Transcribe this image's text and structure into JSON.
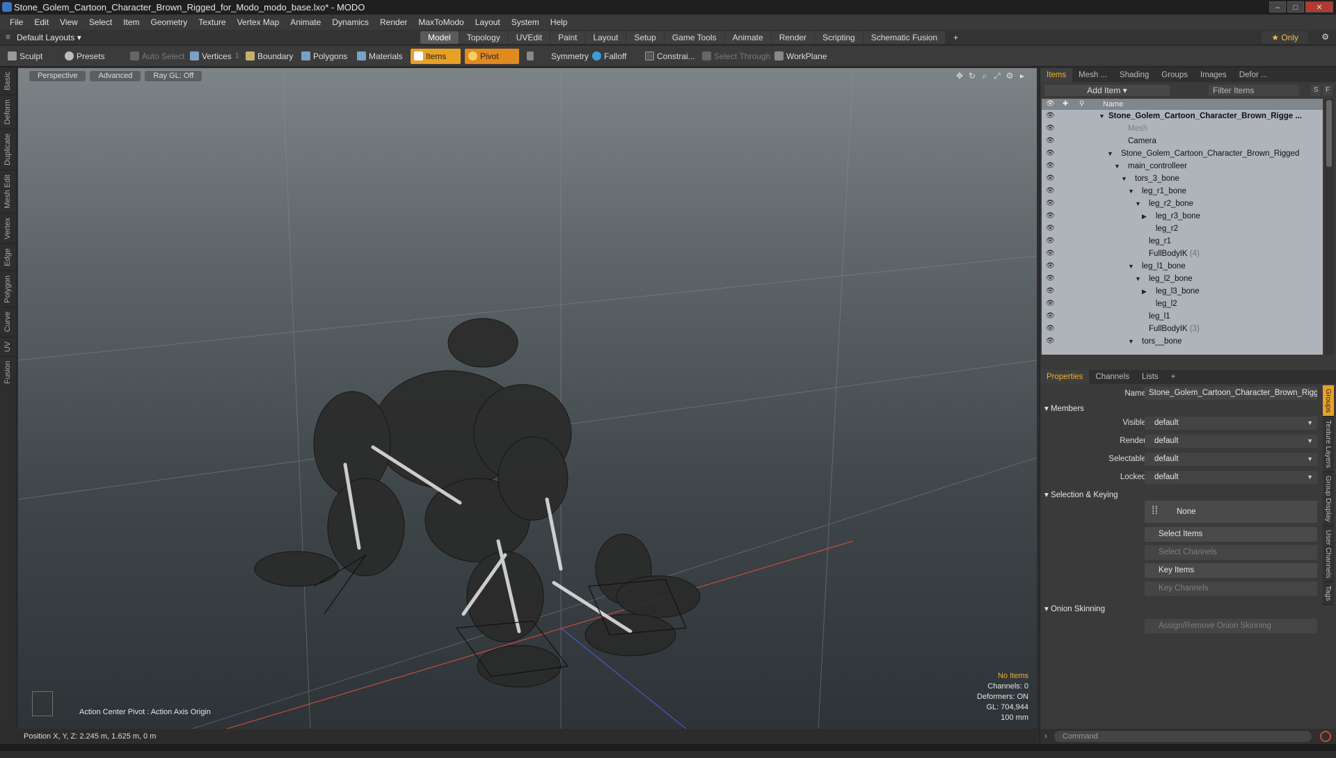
{
  "window": {
    "title": "Stone_Golem_Cartoon_Character_Brown_Rigged_for_Modo_modo_base.lxo* - MODO"
  },
  "menu": [
    "File",
    "Edit",
    "View",
    "Select",
    "Item",
    "Geometry",
    "Texture",
    "Vertex Map",
    "Animate",
    "Dynamics",
    "Render",
    "MaxToModo",
    "Layout",
    "System",
    "Help"
  ],
  "layout_bar": {
    "layout_selector": "Default Layouts",
    "tabs": [
      "Model",
      "Topology",
      "UVEdit",
      "Paint",
      "Layout",
      "Setup",
      "Game Tools",
      "Animate",
      "Render",
      "Scripting",
      "Schematic Fusion"
    ],
    "add_tab": "+",
    "only_label": "Only"
  },
  "toolbar": {
    "sculpt": "Sculpt",
    "presets": "Presets",
    "auto_select": "Auto Select",
    "vertices": "Vertices",
    "vertices_count": "1",
    "boundary": "Boundary",
    "polygons": "Polygons",
    "materials": "Materials",
    "items": "Items",
    "pivot": "Pivot",
    "symmetry": "Symmetry",
    "falloff": "Falloff",
    "constrain": "Constrai...",
    "select_through": "Select Through",
    "workplane": "WorkPlane"
  },
  "left_tabs": [
    "Basic",
    "Deform",
    "Duplicate",
    "Mesh Edit",
    "Vertex",
    "Edge",
    "Polygon",
    "Curve",
    "UV",
    "Fusion"
  ],
  "viewport": {
    "view_mode": "Perspective",
    "shading": "Advanced",
    "raygl": "Ray GL: Off",
    "action_center": "Action Center Pivot : Action Axis Origin",
    "hud": {
      "no_items": "No Items",
      "channels": "Channels: 0",
      "deformers": "Deformers: ON",
      "gl": "GL: 704,944",
      "scale": "100 mm"
    }
  },
  "status_bar": {
    "position_label": "Position X, Y, Z:",
    "position_value": "2.245 m, 1.625 m, 0 m"
  },
  "items_panel": {
    "tabs": [
      "Items",
      "Mesh ...",
      "Shading",
      "Groups",
      "Images",
      "Defor ..."
    ],
    "add_item": "Add Item",
    "filter_placeholder": "Filter Items",
    "s_btn": "S",
    "f_btn": "F",
    "column_name": "Name",
    "rows": [
      {
        "label": "Stone_Golem_Cartoon_Character_Brown_Rigge ...",
        "count": ""
      },
      {
        "label": "Mesh",
        "count": ""
      },
      {
        "label": "Camera",
        "count": ""
      },
      {
        "label": "Stone_Golem_Cartoon_Character_Brown_Rigged",
        "count": ""
      },
      {
        "label": "main_controlleer",
        "count": ""
      },
      {
        "label": "tors_3_bone",
        "count": ""
      },
      {
        "label": "leg_r1_bone",
        "count": ""
      },
      {
        "label": "leg_r2_bone",
        "count": ""
      },
      {
        "label": "leg_r3_bone",
        "count": ""
      },
      {
        "label": "leg_r2",
        "count": ""
      },
      {
        "label": "leg_r1",
        "count": ""
      },
      {
        "label": "FullBodyIK",
        "count": "(4)"
      },
      {
        "label": "leg_l1_bone",
        "count": ""
      },
      {
        "label": "leg_l2_bone",
        "count": ""
      },
      {
        "label": "leg_l3_bone",
        "count": ""
      },
      {
        "label": "leg_l2",
        "count": ""
      },
      {
        "label": "leg_l1",
        "count": ""
      },
      {
        "label": "FullBodyIK",
        "count": "(3)"
      },
      {
        "label": "tors__bone",
        "count": ""
      }
    ]
  },
  "properties_panel": {
    "tabs": [
      "Properties",
      "Channels",
      "Lists",
      "+"
    ],
    "name_label": "Name",
    "name_value": "Stone_Golem_Cartoon_Character_Brown_Rigged",
    "members_section": "Members",
    "visible_label": "Visible",
    "visible_value": "default",
    "render_label": "Render",
    "render_value": "default",
    "selectable_label": "Selectable",
    "selectable_value": "default",
    "locked_label": "Locked",
    "locked_value": "default",
    "selection_section": "Selection & Keying",
    "none_btn": "None",
    "select_items": "Select Items",
    "select_channels": "Select Channels",
    "key_items": "Key Items",
    "key_channels": "Key Channels",
    "onion_section": "Onion Skinning",
    "assign_onion": "Assign/Remove Onion Skinning",
    "side_tabs": [
      "Groups",
      "Texture Layers",
      "Group Display",
      "User Channels",
      "Tags"
    ]
  },
  "command": {
    "placeholder": "Command"
  },
  "colors": {
    "accent": "#e8a127",
    "hud_highlight": "#f0b030",
    "list_bg": "#aeb4b9"
  }
}
